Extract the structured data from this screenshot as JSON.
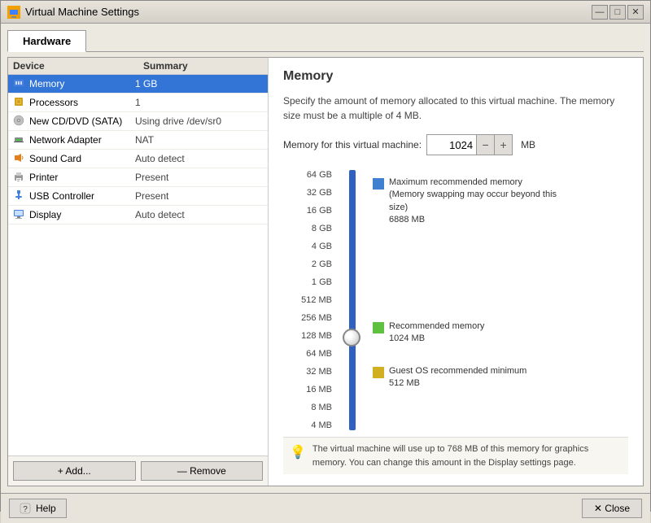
{
  "window": {
    "title": "Virtual Machine Settings",
    "icon": "vm-icon"
  },
  "titlebar": {
    "minimize": "—",
    "maximize": "□",
    "close": "✕"
  },
  "tabs": [
    {
      "id": "hardware",
      "label": "Hardware",
      "active": true
    }
  ],
  "device_list": {
    "col_device": "Device",
    "col_summary": "Summary",
    "devices": [
      {
        "id": "memory",
        "name": "Memory",
        "summary": "1 GB",
        "selected": true
      },
      {
        "id": "processors",
        "name": "Processors",
        "summary": "1",
        "selected": false
      },
      {
        "id": "cd-dvd",
        "name": "New CD/DVD (SATA)",
        "summary": "Using drive /dev/sr0",
        "selected": false
      },
      {
        "id": "network",
        "name": "Network Adapter",
        "summary": "NAT",
        "selected": false
      },
      {
        "id": "sound",
        "name": "Sound Card",
        "summary": "Auto detect",
        "selected": false
      },
      {
        "id": "printer",
        "name": "Printer",
        "summary": "Present",
        "selected": false
      },
      {
        "id": "usb",
        "name": "USB Controller",
        "summary": "Present",
        "selected": false
      },
      {
        "id": "display",
        "name": "Display",
        "summary": "Auto detect",
        "selected": false
      }
    ]
  },
  "buttons": {
    "add": "+ Add...",
    "remove": "— Remove"
  },
  "memory_panel": {
    "title": "Memory",
    "description": "Specify the amount of memory allocated to this virtual machine. The memory size must be a multiple of 4 MB.",
    "input_label": "Memory for this virtual machine:",
    "value": "1024",
    "unit": "MB",
    "slider_labels": [
      "64 GB",
      "32 GB",
      "16 GB",
      "8 GB",
      "4 GB",
      "2 GB",
      "1 GB",
      "512 MB",
      "256 MB",
      "128 MB",
      "64 MB",
      "32 MB",
      "16 MB",
      "8 MB",
      "4 MB"
    ],
    "legend": {
      "max_recommended": {
        "label": "Maximum recommended memory",
        "sublabel": "(Memory swapping may occur beyond this size)",
        "value": "6888 MB",
        "color": "blue"
      },
      "recommended": {
        "label": "Recommended memory",
        "value": "1024 MB",
        "color": "green"
      },
      "guest_min": {
        "label": "Guest OS recommended minimum",
        "value": "512 MB",
        "color": "yellow"
      }
    },
    "bottom_note": "The virtual machine will use up to 768 MB of this memory for graphics memory. You can change this amount in the Display settings page."
  },
  "footer": {
    "help": "Help",
    "close": "✕  Close"
  }
}
